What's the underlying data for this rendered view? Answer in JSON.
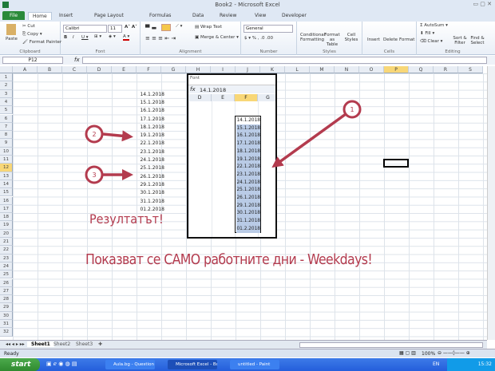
{
  "window": {
    "title": "Book2 - Microsoft Excel"
  },
  "tabs": [
    "File",
    "Home",
    "Insert",
    "Page Layout",
    "Formulas",
    "Data",
    "Review",
    "View",
    "Developer"
  ],
  "ribbon": {
    "clipboard": {
      "label": "Clipboard",
      "paste": "Paste",
      "cut": "Cut",
      "copy": "Copy",
      "format_painter": "Format Painter"
    },
    "font": {
      "label": "Font",
      "name": "Calibri",
      "size": "11"
    },
    "alignment": {
      "label": "Alignment",
      "wrap": "Wrap Text",
      "merge": "Merge & Center"
    },
    "number": {
      "label": "Number",
      "format": "General"
    },
    "styles": {
      "label": "Styles",
      "cond": "Conditional Formatting",
      "table": "Format as Table",
      "cell": "Cell Styles"
    },
    "cells": {
      "label": "Cells",
      "insert": "Insert",
      "delete": "Delete",
      "format": "Format"
    },
    "editing": {
      "label": "Editing",
      "autosum": "AutoSum",
      "fill": "Fill",
      "clear": "Clear",
      "sort": "Sort & Filter",
      "find": "Find & Select"
    }
  },
  "formula_bar": {
    "name_box": "P12",
    "fx": "fx",
    "value": ""
  },
  "columns": [
    "A",
    "B",
    "C",
    "D",
    "E",
    "F",
    "G",
    "H",
    "I",
    "J",
    "K",
    "L",
    "M",
    "N",
    "O",
    "P",
    "Q",
    "R",
    "S"
  ],
  "selected_column": "P",
  "selected_row": 12,
  "rows": [
    1,
    2,
    3,
    4,
    5,
    6,
    7,
    8,
    9,
    10,
    11,
    12,
    13,
    14,
    15,
    16,
    17,
    18,
    19,
    20,
    21,
    22,
    23,
    24,
    25,
    26,
    27,
    28,
    29,
    30,
    31,
    32
  ],
  "dates": [
    "14.1.2018",
    "15.1.2018",
    "16.1.2018",
    "17.1.2018",
    "18.1.2018",
    "19.1.2018",
    "22.1.2018",
    "23.1.2018",
    "24.1.2018",
    "25.1.2018",
    "26.1.2018",
    "29.1.2018",
    "30.1.2018",
    "31.1.2018",
    "01.2.2018"
  ],
  "inset": {
    "group_label": "Font",
    "formula_value": "14.1.2018",
    "columns": [
      "D",
      "E",
      "F",
      "G"
    ],
    "selected_column": "F"
  },
  "annotations": {
    "markers": [
      "1",
      "2",
      "3"
    ],
    "result": "Резултатът!",
    "caption": "Показват се САМО работните дни - Weekdays!",
    "color": "#b33b4e"
  },
  "sheets": [
    "Sheet1",
    "Sheet2",
    "Sheet3"
  ],
  "status": {
    "ready": "Ready",
    "zoom": "100%"
  },
  "taskbar": {
    "start": "start",
    "tasks": [
      "Aula.bg - Question - ...",
      "Microsoft Excel - Book2",
      "untitled - Paint"
    ],
    "lang": "EN",
    "clock": "15:32"
  }
}
